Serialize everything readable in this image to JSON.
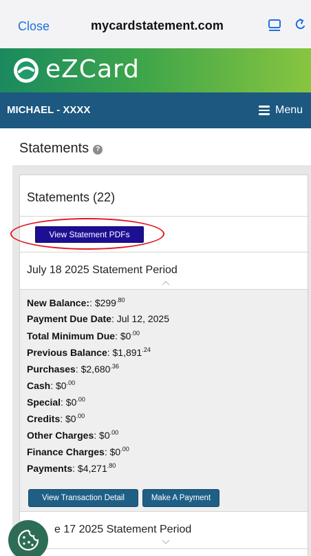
{
  "browser": {
    "close_label": "Close",
    "url": "mycardstatement.com",
    "tabs_icon": "tabs-icon",
    "reload_icon": "reload-icon"
  },
  "brand": {
    "name": "eZCard",
    "logo_icon": "ezcard-logo-icon"
  },
  "user_bar": {
    "user_label": "MICHAEL - XXXX",
    "menu_label": "Menu",
    "menu_icon": "hamburger-icon"
  },
  "page": {
    "title": "Statements",
    "help_icon": "question-circle-icon"
  },
  "statements_card": {
    "heading": "Statements (22)",
    "view_pdfs_label": "View Statement PDFs"
  },
  "periods": [
    {
      "label": "July 18 2025 Statement Period",
      "expanded": true,
      "details": [
        {
          "label": "New Balance:",
          "value": ": $299",
          "cents": ".80"
        },
        {
          "label": "Payment Due Date",
          "value": ": Jul 12, 2025",
          "cents": ""
        },
        {
          "label": "Total Minimum Due",
          "value": ": $0",
          "cents": ".00"
        },
        {
          "label": "Previous Balance",
          "value": ": $1,891",
          "cents": ".24"
        },
        {
          "label": "Purchases",
          "value": ": $2,680",
          "cents": ".36"
        },
        {
          "label": "Cash",
          "value": ": $0",
          "cents": ".00"
        },
        {
          "label": "Special",
          "value": ": $0",
          "cents": ".00"
        },
        {
          "label": "Credits",
          "value": ": $0",
          "cents": ".00"
        },
        {
          "label": "Other Charges",
          "value": ": $0",
          "cents": ".00"
        },
        {
          "label": "Finance Charges",
          "value": ": $0",
          "cents": ".00"
        },
        {
          "label": "Payments",
          "value": ": $4,271",
          "cents": ".80"
        }
      ],
      "view_transactions_label": "View Transaction Detail",
      "make_payment_label": "Make A Payment"
    },
    {
      "label": "e 17 2025 Statement Period",
      "expanded": false
    }
  ],
  "cookie_button_icon": "cookie-icon",
  "colors": {
    "nav_blue": "#1c5880",
    "pdf_button": "#1d0f94",
    "action_button": "#1f5f86",
    "highlight_oval": "#e0141e",
    "brand_green": "#3ea54a"
  }
}
